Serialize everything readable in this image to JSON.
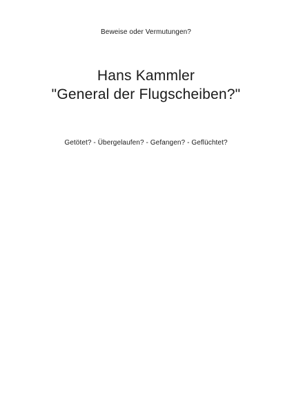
{
  "cover": {
    "supertitle": "Beweise oder Vermutungen?",
    "author": "Hans Kammler",
    "title": "\"General der Flugscheiben?\"",
    "subtitle": "Getötet? - Übergelaufen? - Gefangen? - Geflüchtet?"
  },
  "colors": {
    "background": "#ffffff",
    "text": "#1a1a1a"
  }
}
